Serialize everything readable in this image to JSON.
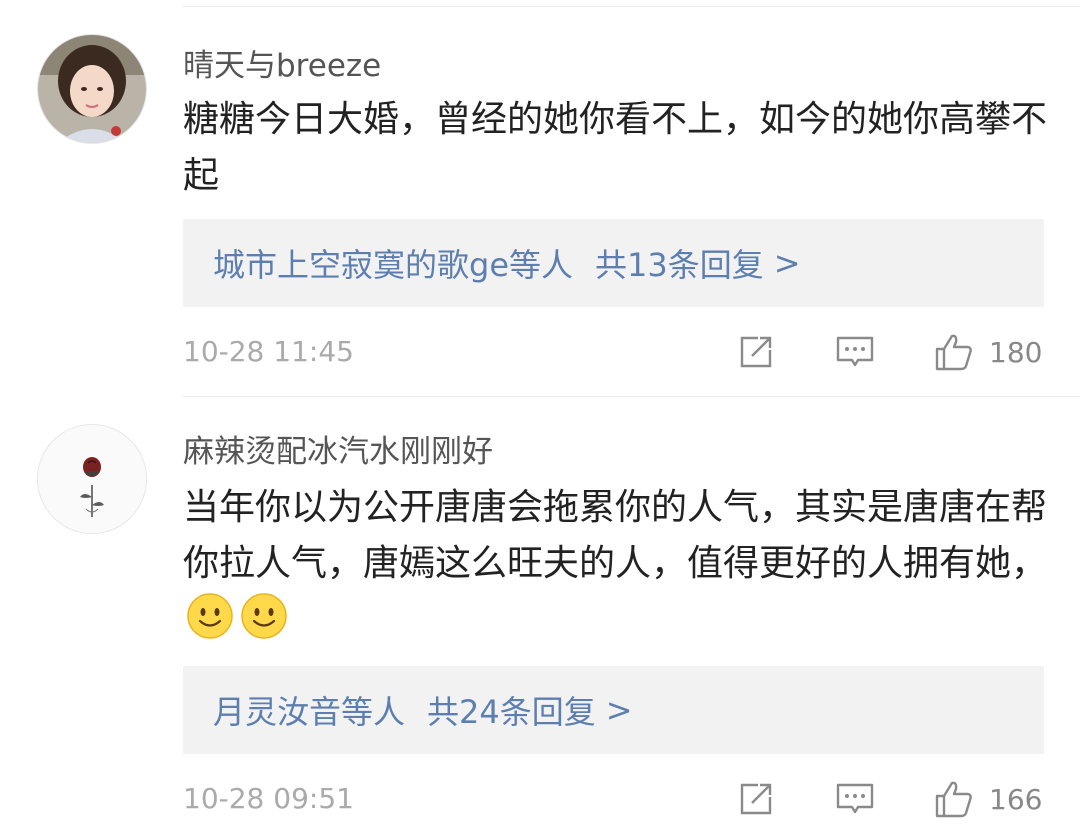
{
  "comments": [
    {
      "username": "晴天与breeze",
      "text": "糖糖今日大婚，曾经的她你看不上，如今的她你高攀不起",
      "emojis": [],
      "reply_names": "城市上空寂寞的歌ge等人",
      "reply_count": "共13条回复",
      "reply_chevron": ">",
      "time": "10-28 11:45",
      "likes": "180",
      "avatar_icon": "portrait-photo"
    },
    {
      "username": "麻辣烫配冰汽水刚刚好",
      "text": "当年你以为公开唐唐会拖累你的人气，其实是唐唐在帮你拉人气，唐嫣这么旺夫的人，值得更好的人拥有她，",
      "emojis": [
        "smile-emoji",
        "smile-emoji"
      ],
      "reply_names": "月灵汝音等人",
      "reply_count": "共24条回复",
      "reply_chevron": ">",
      "time": "10-28 09:51",
      "likes": "166",
      "avatar_icon": "rose-sketch"
    }
  ],
  "icons": {
    "forward": "share-icon",
    "comment": "comment-icon",
    "like": "thumbs-up-icon"
  },
  "colors": {
    "link": "#5d7faf",
    "reply_bg": "#f2f2f2",
    "meta": "#aaaaaa"
  }
}
